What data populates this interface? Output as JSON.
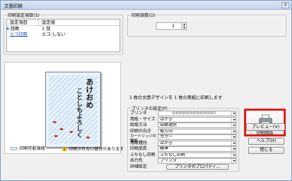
{
  "window": {
    "title": "文面印刷",
    "close_glyph": "✕"
  },
  "settings_group": {
    "label": "印刷設定項目(S)",
    "headers": [
      "設定項目",
      "設定値"
    ],
    "rows": [
      {
        "key": "部数",
        "value": "1 部"
      },
      {
        "key": "エコ印刷",
        "value": "エコ:しない"
      }
    ]
  },
  "copies_group": {
    "label": "印刷部数(O)",
    "value": "1",
    "up": "▲",
    "down": "▼"
  },
  "preview": {
    "card_title_right": "あけおめ",
    "card_title_left": "ことしもよろしく",
    "legend_printable": "印刷可能領域",
    "legend_warning": "印刷されない部分があります"
  },
  "info_text": "1 枚の文面デザインを 1 枚の用紙に印刷します",
  "printer_group": {
    "label": "プリンタの設定(P)",
    "rows": [
      {
        "label": "プリンタ",
        "value": ""
      },
      {
        "label": "用紙・サイズ",
        "value": "はがき"
      },
      {
        "label": "給紙方法",
        "value": "自動選択"
      },
      {
        "label": "印刷の向き",
        "value": "縦方向"
      },
      {
        "label": "カートリッジの種類",
        "value": "カラー"
      },
      {
        "label": "用紙種別",
        "value": "はがき"
      },
      {
        "label": "印刷品質",
        "value": "標準"
      },
      {
        "label": "ふちなし印刷",
        "value": "ふちなし印刷"
      },
      {
        "label": "出力先",
        "value": "プリンタ"
      },
      {
        "label": "詳細設定",
        "value": "プリンタのプロパティ..."
      }
    ]
  },
  "buttons": {
    "print": "印刷開始",
    "preview": "プレビュー(V)",
    "help": "ヘルプ(H)",
    "close": "閉じる"
  },
  "colors": {
    "print_highlight": "#e41b17",
    "link": "#1a55c8",
    "title_bar": "#c4d6ee"
  },
  "icons": [
    "printer-icon",
    "warning-icon",
    "close-icon",
    "spin-up-icon",
    "spin-down-icon",
    "dropdown-arrow-icon"
  ]
}
